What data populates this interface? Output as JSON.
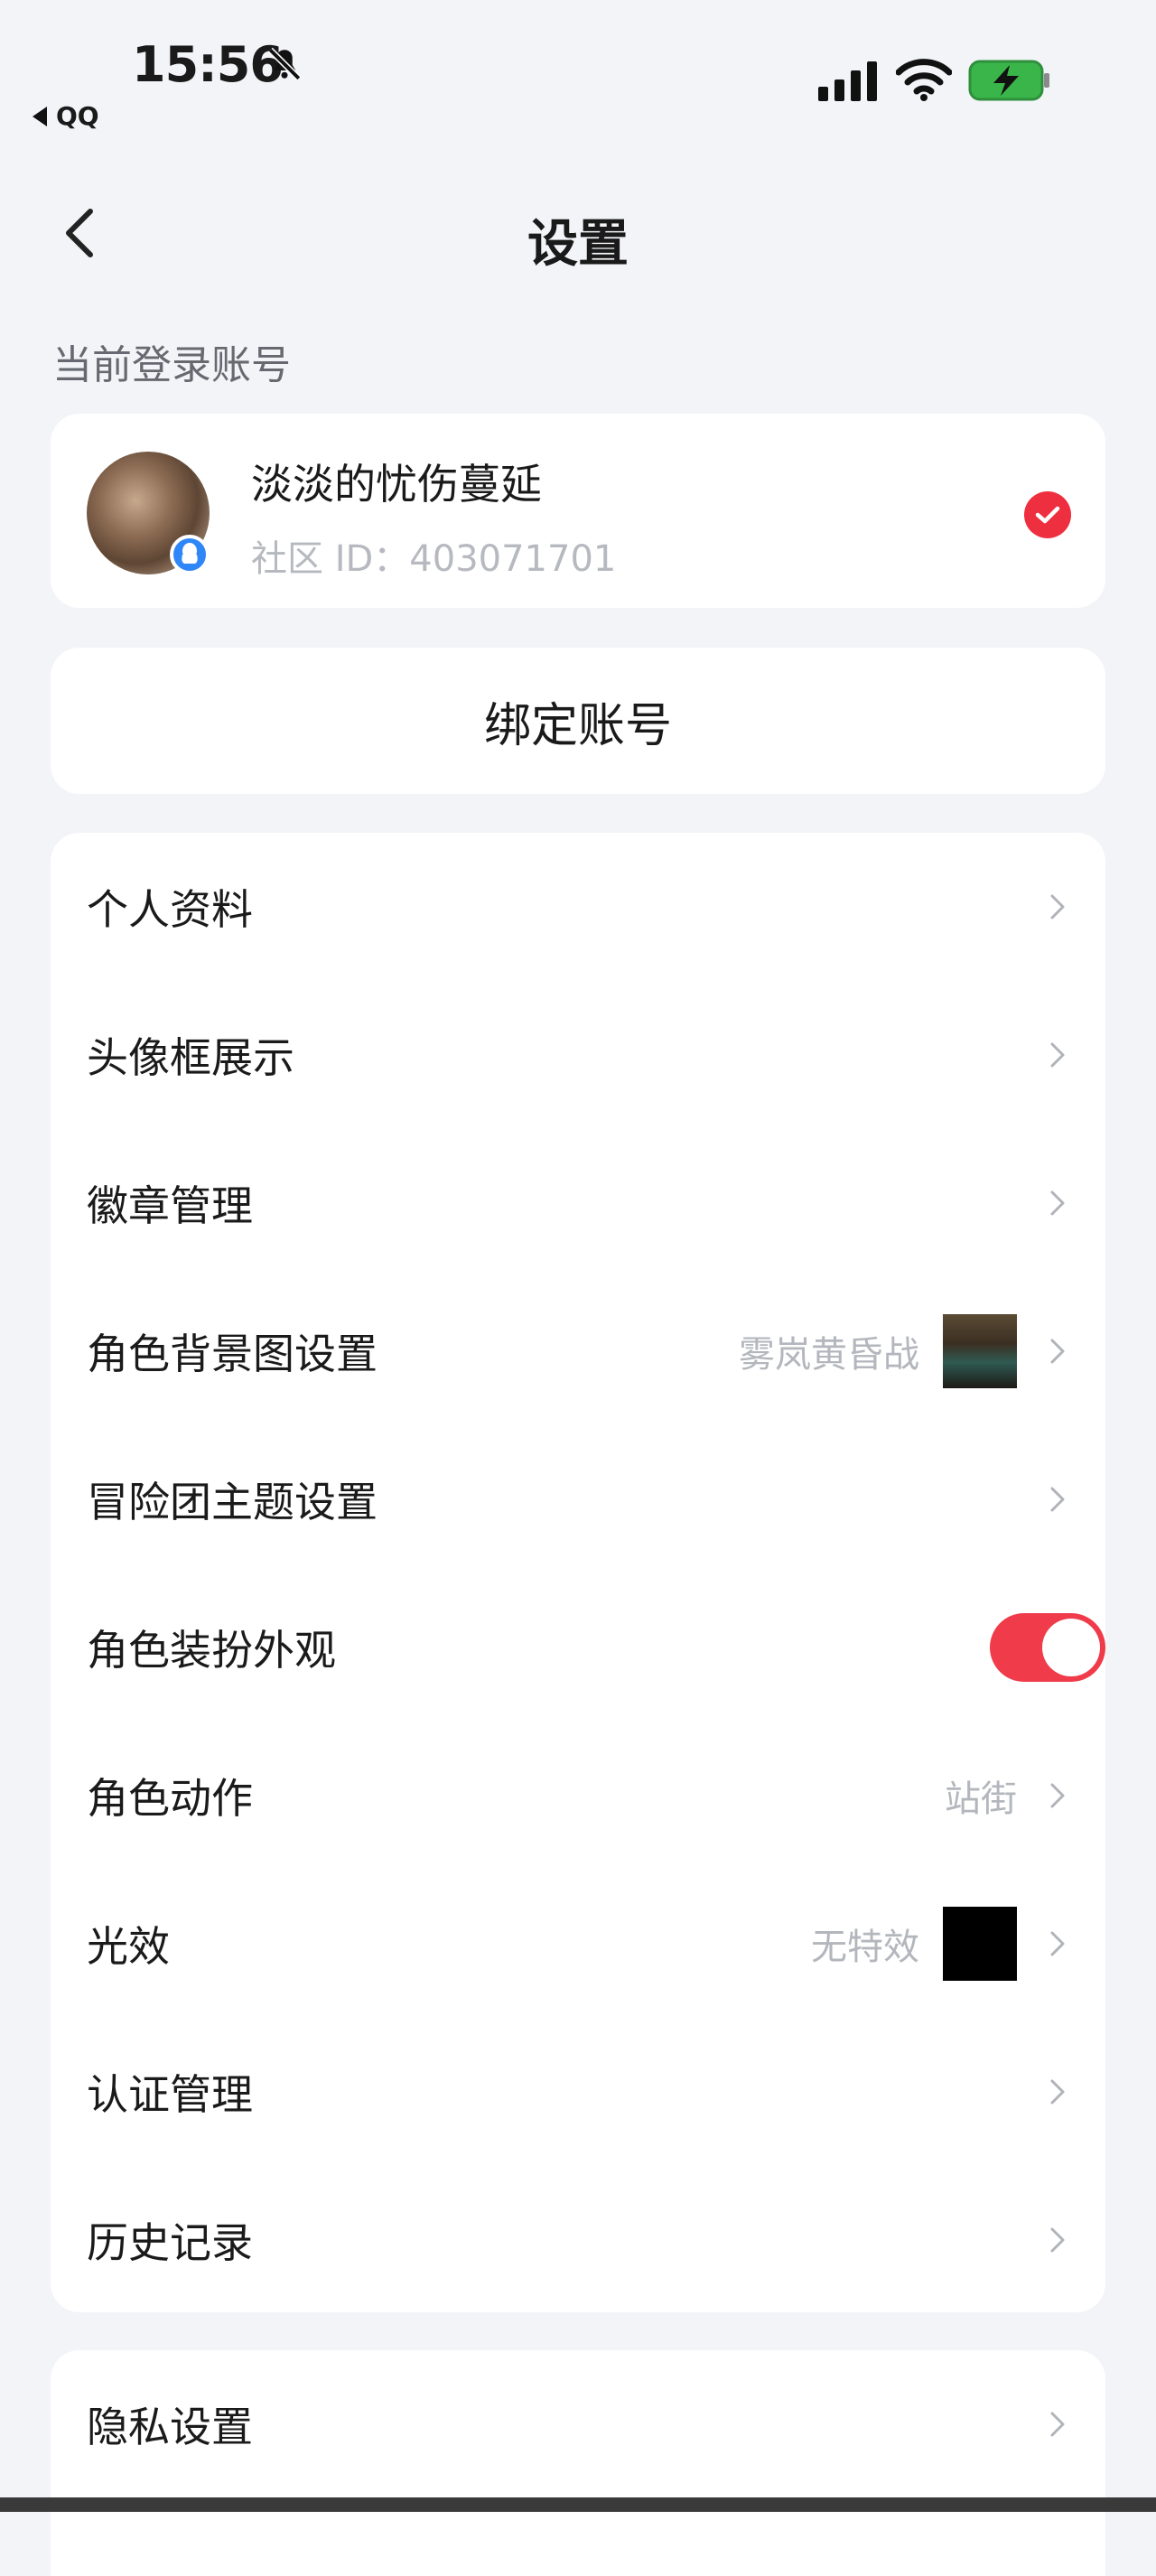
{
  "status_bar": {
    "time": "15:56",
    "back_app": "QQ",
    "icons": [
      "bell-muted-icon",
      "signal-icon",
      "wifi-icon",
      "battery-charging-icon"
    ],
    "battery_color": "#3ab54a"
  },
  "header": {
    "title": "设置",
    "back_icon": "chevron-left-icon"
  },
  "account_section": {
    "label": "当前登录账号",
    "username": "淡淡的忧伤蔓延",
    "community_id": "社区 ID：403071701",
    "selected": true,
    "accent_color": "#ee2f3f"
  },
  "bind_account": {
    "label": "绑定账号"
  },
  "menu": {
    "items": [
      {
        "label": "个人资料"
      },
      {
        "label": "头像框展示"
      },
      {
        "label": "徽章管理"
      },
      {
        "label": "角色背景图设置",
        "value": "雾岚黄昏战"
      },
      {
        "label": "冒险团主题设置"
      },
      {
        "label": "角色装扮外观",
        "toggle_on": true
      },
      {
        "label": "角色动作",
        "value": "站街"
      },
      {
        "label": "光效",
        "value": "无特效"
      },
      {
        "label": "认证管理"
      },
      {
        "label": "历史记录"
      }
    ]
  },
  "menu2": {
    "items": [
      {
        "label": "隐私设置"
      }
    ]
  }
}
